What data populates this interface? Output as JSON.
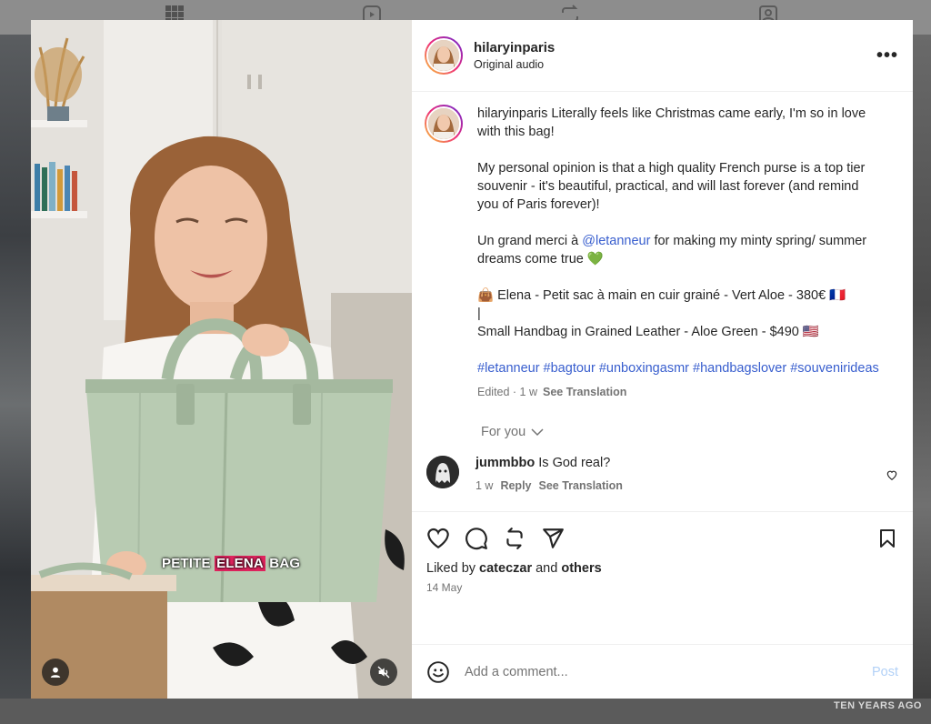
{
  "post": {
    "username": "hilaryinparis",
    "audio": "Original audio",
    "more_label": "•••",
    "caption": {
      "username": "hilaryinparis",
      "line1": "Literally feels like Christmas came early, I'm so in love with this bag!",
      "para2": "My personal opinion is that a high quality French purse is a top tier souvenir - it's beautiful, practical, and will last forever (and remind you of Paris forever)!",
      "para3_before": "Un grand merci à ",
      "para3_mention": "@letanneur",
      "para3_after": " for making my minty spring/ summer dreams come true 💚",
      "para4_line1": "👜 Elena - Petit sac à main en cuir grainé - Vert Aloe - 380€ 🇫🇷",
      "para4_line2": "|",
      "para4_line3": "Small Handbag in Grained Leather - Aloe Green - $490 🇺🇸",
      "hashtags": "#letanneur #bagtour #unboxingasmr #handbagslover #souvenirideas"
    },
    "edited": "Edited · 1 w",
    "see_translation": "See Translation"
  },
  "for_you": "For you",
  "comments": [
    {
      "username": "jummbbo",
      "text": "Is God real?",
      "age": "1 w",
      "reply": "Reply",
      "see_translation": "See Translation"
    }
  ],
  "video": {
    "overlay_prefix": "PETITE ",
    "overlay_highlight": "ELENA",
    "overlay_suffix": " BAG"
  },
  "likes": {
    "prefix": "Liked by ",
    "user": "cateczar",
    "middle": " and ",
    "others": "others"
  },
  "date": "14 May",
  "comment_box": {
    "placeholder": "Add a comment...",
    "post_label": "Post"
  },
  "background": {
    "bottom_text": "TEN YEARS AGO"
  },
  "colors": {
    "link": "#385ece",
    "post_disabled": "#b2d1f7",
    "story_ring": [
      "#f9ce34",
      "#ee2a7b",
      "#6228d7"
    ]
  }
}
